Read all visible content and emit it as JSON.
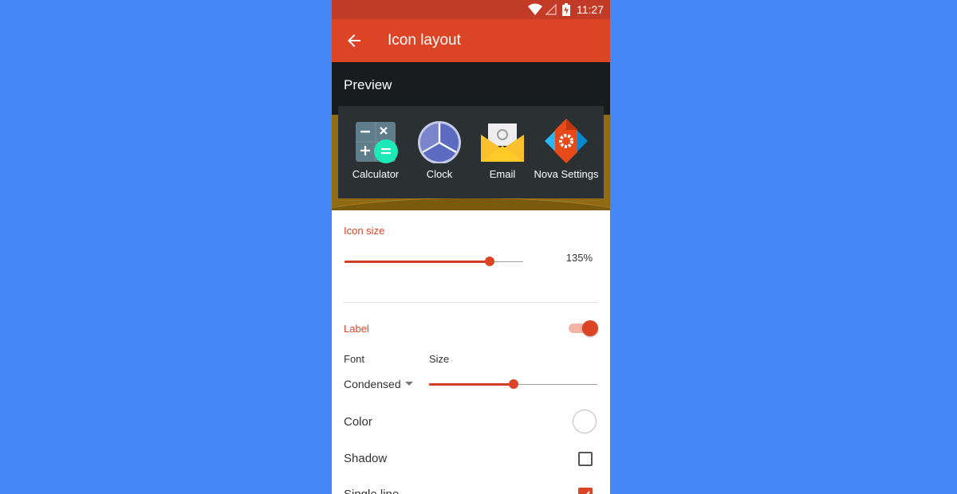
{
  "status_bar": {
    "time": "11:27"
  },
  "app_bar": {
    "title": "Icon layout",
    "back_icon": "arrow-back-icon"
  },
  "preview": {
    "title": "Preview",
    "apps": [
      {
        "label": "Calculator",
        "icon": "calculator-icon"
      },
      {
        "label": "Clock",
        "icon": "clock-icon"
      },
      {
        "label": "Email",
        "icon": "email-icon"
      },
      {
        "label": "Nova Settings",
        "icon": "nova-settings-icon"
      }
    ]
  },
  "icon_size": {
    "title": "Icon size",
    "value_text": "135%",
    "slider_fraction": 0.81
  },
  "label": {
    "title": "Label",
    "enabled": true,
    "font_label": "Font",
    "font_value": "Condensed",
    "size_label": "Size",
    "size_slider_fraction": 0.5
  },
  "rows": {
    "color": "Color",
    "shadow": "Shadow",
    "single_line": "Single line"
  },
  "colors": {
    "accent": "#db4425",
    "status_bar": "#c23b26",
    "background": "#4587f4"
  }
}
